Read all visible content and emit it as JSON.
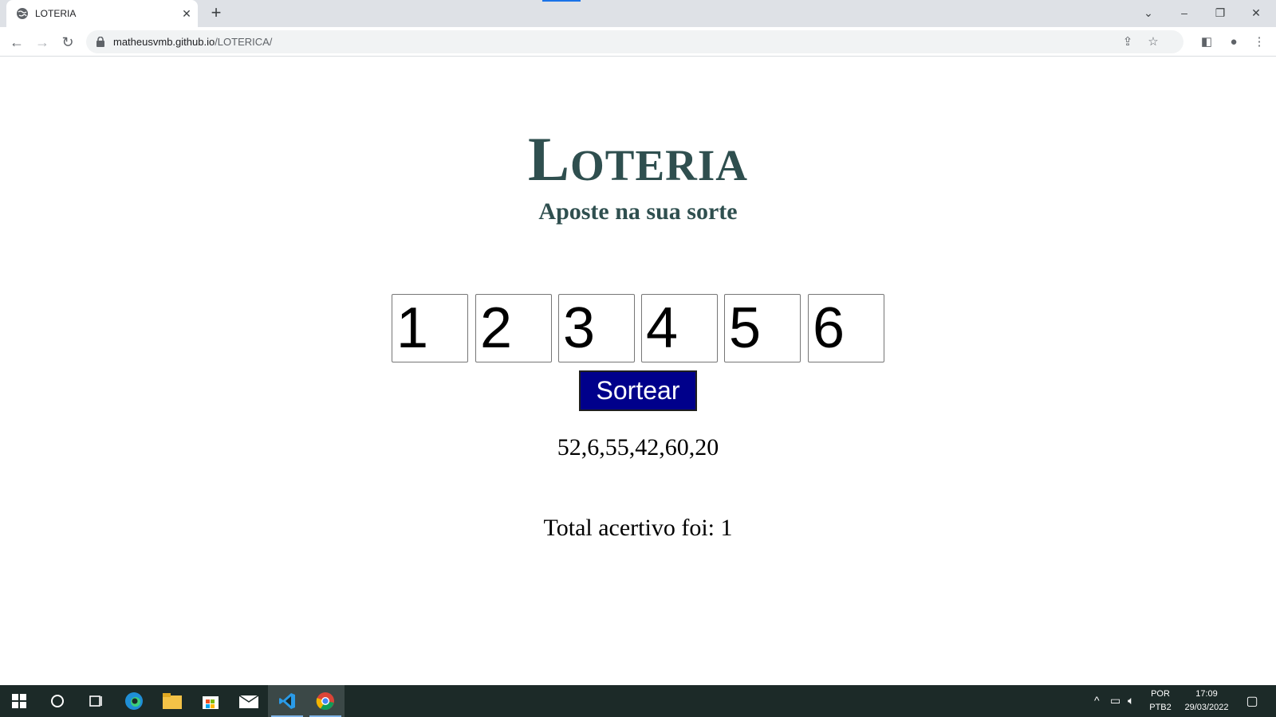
{
  "browser": {
    "tab_title": "LOTERIA",
    "url_host": "matheusvmb.github.io",
    "url_path": "/LOTERICA/"
  },
  "page": {
    "title": "Loteria",
    "subtitle": "Aposte na sua sorte",
    "inputs": [
      "1",
      "2",
      "3",
      "4",
      "5",
      "6"
    ],
    "button_label": "Sortear",
    "drawn_numbers": "52,6,55,42,60,20",
    "result_text": "Total acertivo foi: 1"
  },
  "taskbar": {
    "lang_top": "POR",
    "lang_bottom": "PTB2",
    "time": "17:09",
    "date": "29/03/2022"
  },
  "colors": {
    "title": "#2f4f4f",
    "button_bg": "#00008b",
    "taskbar_bg": "#1c2a28"
  }
}
